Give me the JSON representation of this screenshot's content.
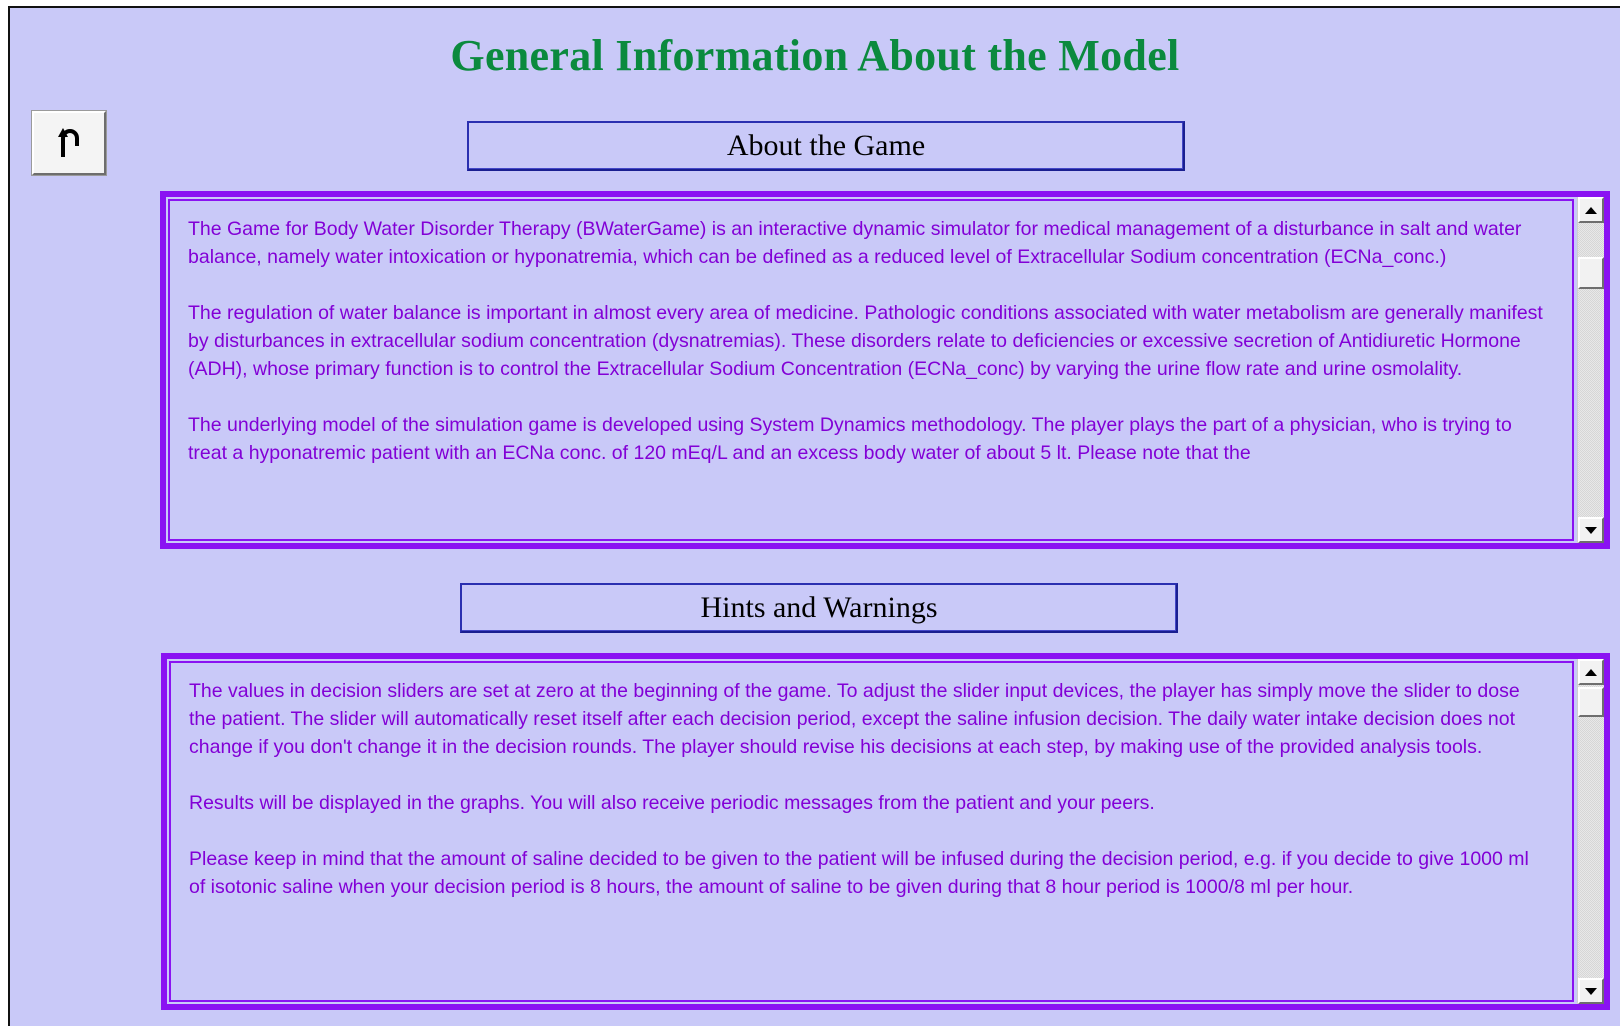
{
  "page": {
    "title": "General Information About the Model",
    "back_icon": "return-arrow-icon"
  },
  "about": {
    "heading": "About the Game",
    "paragraphs": [
      "The Game for Body Water Disorder Therapy (BWaterGame) is an interactive dynamic simulator for medical management of a disturbance in salt and water balance, namely water intoxication or hyponatremia, which can be defined as a reduced level of Extracellular Sodium concentration (ECNa_conc.)",
      "The regulation of water balance is important in almost every area of medicine. Pathologic conditions associated with water metabolism are generally manifest by disturbances in extracellular sodium concentration (dysnatremias). These disorders relate to deficiencies or excessive secretion of Antidiuretic Hormone (ADH), whose primary function is to control the Extracellular Sodium Concentration (ECNa_conc) by varying the urine flow rate and urine osmolality.",
      "The underlying model of the simulation game is developed using System Dynamics methodology. The player plays the part of a physician, who is trying to treat a hyponatremic patient with an ECNa conc. of 120 mEq/L and an excess body water of about 5 lt. Please note that the"
    ]
  },
  "hints": {
    "heading": "Hints and Warnings",
    "paragraphs": [
      "The values in decision sliders are set at zero at the beginning of the game. To adjust the slider input devices, the player has simply move the slider to dose the patient. The slider will automatically reset itself after each decision period, except the saline infusion decision. The daily water intake decision does not change if you don't change it in the decision rounds. The player should revise his decisions at each step, by making use of the provided analysis tools.",
      "Results will be displayed in the graphs.  You will also receive periodic messages from the patient and your peers.",
      "Please keep in mind that the amount of saline decided to be given to the patient will be infused during the decision period, e.g. if you decide to give 1000 ml of isotonic saline when your decision period is 8 hours, the amount of saline to be given during that 8 hour period is 1000/8 ml per hour."
    ]
  },
  "colors": {
    "background": "#c9c9f8",
    "title": "#0b8a3e",
    "panel_border": "#8a12f2",
    "panel_text": "#8200d6",
    "header_border": "#2a2fb0"
  }
}
